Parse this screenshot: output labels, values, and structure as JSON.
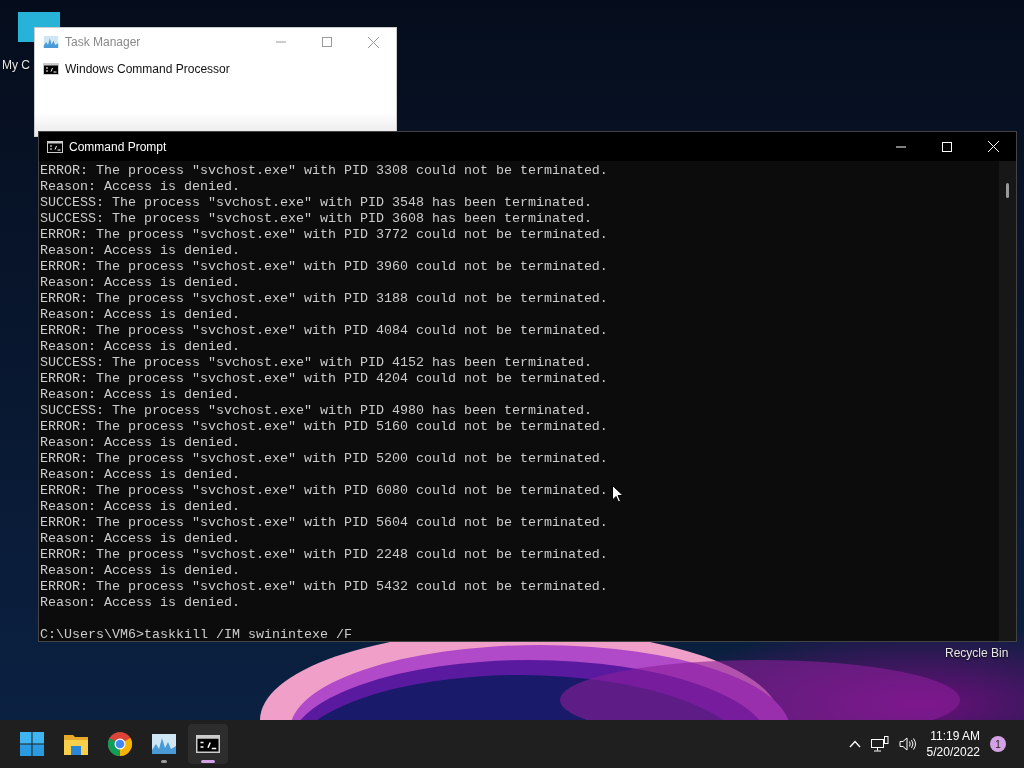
{
  "desktop": {
    "icons": [
      {
        "label": "My C",
        "kind": "computer"
      },
      {
        "label": "Recycle Bin",
        "kind": "bin"
      }
    ]
  },
  "task_manager": {
    "title": "Task Manager",
    "items": [
      {
        "label": "Windows Command Processor"
      }
    ]
  },
  "command_prompt": {
    "title": "Command Prompt",
    "lines": [
      "ERROR: The process \"svchost.exe\" with PID 3308 could not be terminated.",
      "Reason: Access is denied.",
      "SUCCESS: The process \"svchost.exe\" with PID 3548 has been terminated.",
      "SUCCESS: The process \"svchost.exe\" with PID 3608 has been terminated.",
      "ERROR: The process \"svchost.exe\" with PID 3772 could not be terminated.",
      "Reason: Access is denied.",
      "ERROR: The process \"svchost.exe\" with PID 3960 could not be terminated.",
      "Reason: Access is denied.",
      "ERROR: The process \"svchost.exe\" with PID 3188 could not be terminated.",
      "Reason: Access is denied.",
      "ERROR: The process \"svchost.exe\" with PID 4084 could not be terminated.",
      "Reason: Access is denied.",
      "SUCCESS: The process \"svchost.exe\" with PID 4152 has been terminated.",
      "ERROR: The process \"svchost.exe\" with PID 4204 could not be terminated.",
      "Reason: Access is denied.",
      "SUCCESS: The process \"svchost.exe\" with PID 4980 has been terminated.",
      "ERROR: The process \"svchost.exe\" with PID 5160 could not be terminated.",
      "Reason: Access is denied.",
      "ERROR: The process \"svchost.exe\" with PID 5200 could not be terminated.",
      "Reason: Access is denied.",
      "ERROR: The process \"svchost.exe\" with PID 6080 could not be terminated.",
      "Reason: Access is denied.",
      "ERROR: The process \"svchost.exe\" with PID 5604 could not be terminated.",
      "Reason: Access is denied.",
      "ERROR: The process \"svchost.exe\" with PID 2248 could not be terminated.",
      "Reason: Access is denied.",
      "ERROR: The process \"svchost.exe\" with PID 5432 could not be terminated.",
      "Reason: Access is denied."
    ],
    "prompt": "C:\\Users\\VM6>taskkill /IM swinintexe /F"
  },
  "taskbar": {
    "apps": [
      {
        "kind": "start",
        "running": false,
        "active": false
      },
      {
        "kind": "folder",
        "running": false,
        "active": false
      },
      {
        "kind": "chrome",
        "running": false,
        "active": false
      },
      {
        "kind": "taskmgr",
        "running": true,
        "active": false
      },
      {
        "kind": "terminal",
        "running": true,
        "active": true
      }
    ],
    "tray": {
      "time": "11:19 AM",
      "date": "5/20/2022",
      "notifications": "1"
    }
  }
}
